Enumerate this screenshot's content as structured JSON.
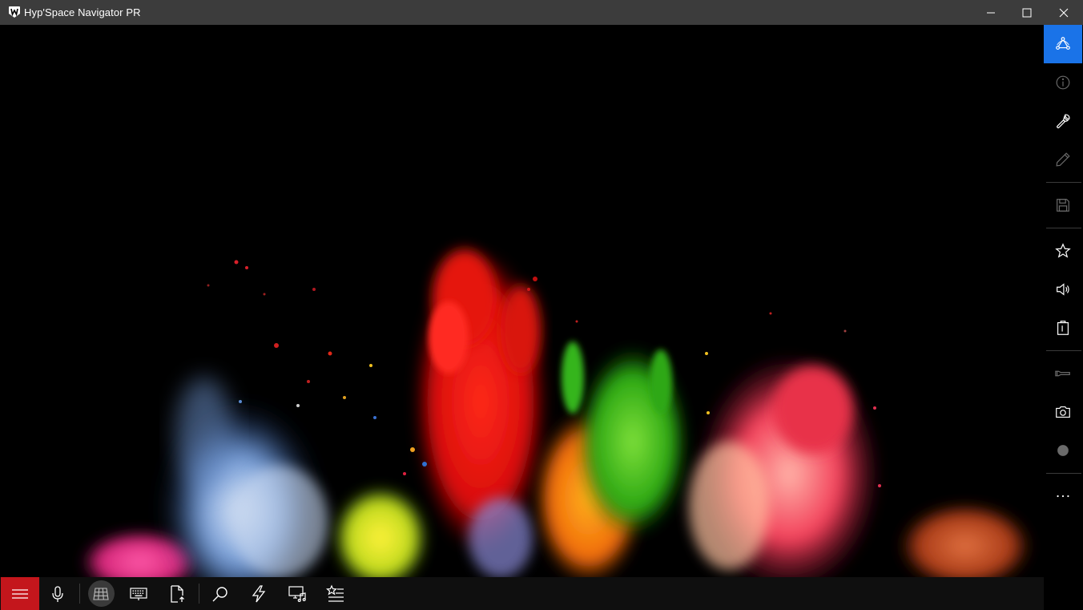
{
  "window": {
    "title": "Hyp'Space Navigator PR",
    "controls": [
      "minimize-icon",
      "maximize-icon",
      "close-icon"
    ]
  },
  "right_toolbar": {
    "items": [
      {
        "icon": "network-nodes-icon",
        "active": true
      },
      {
        "icon": "info-icon",
        "active": false
      },
      {
        "icon": "wrench-icon",
        "active": false
      },
      {
        "icon": "pencil-icon",
        "active": false
      },
      {
        "icon": "save-icon",
        "active": false
      },
      {
        "icon": "star-icon",
        "active": false
      },
      {
        "icon": "speaker-icon",
        "active": false
      },
      {
        "icon": "clipboard-icon",
        "active": false
      },
      {
        "icon": "flashlight-icon",
        "active": false
      },
      {
        "icon": "camera-icon",
        "active": false
      },
      {
        "icon": "record-icon",
        "active": false
      },
      {
        "icon": "more-icon",
        "active": false
      }
    ],
    "accent_color": "#1a73e8"
  },
  "bottom_toolbar": {
    "items": [
      {
        "icon": "hamburger-menu-icon",
        "active": true
      },
      {
        "icon": "microphone-icon"
      },
      {
        "icon": "grid-icon",
        "selected": true
      },
      {
        "icon": "keyboard-icon"
      },
      {
        "icon": "file-upload-icon"
      },
      {
        "icon": "search-icon"
      },
      {
        "icon": "lightning-icon"
      },
      {
        "icon": "media-devices-icon"
      },
      {
        "icon": "favorites-list-icon"
      }
    ],
    "menu_color": "#c4161c"
  },
  "viewport": {
    "content": "remote-desktop-wallpaper",
    "background": "#000000"
  }
}
